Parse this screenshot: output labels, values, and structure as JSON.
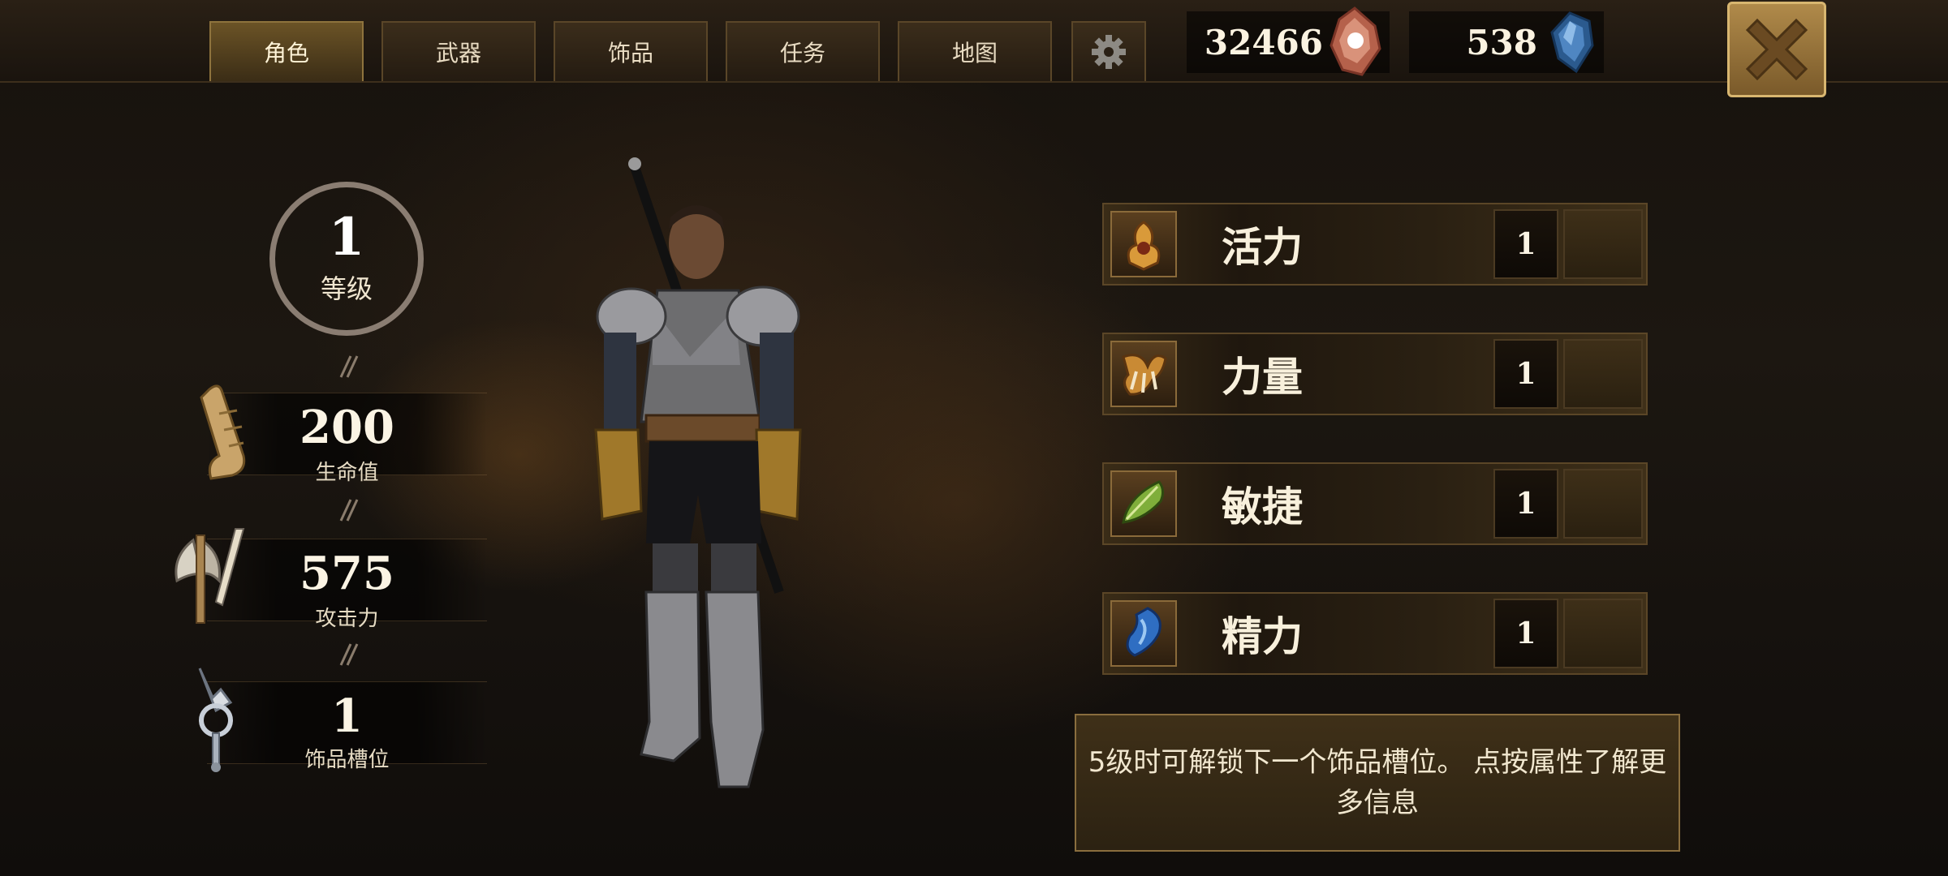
{
  "tabs": [
    {
      "label": "角色",
      "active": true
    },
    {
      "label": "武器",
      "active": false
    },
    {
      "label": "饰品",
      "active": false
    },
    {
      "label": "任务",
      "active": false
    },
    {
      "label": "地图",
      "active": false
    }
  ],
  "currency": {
    "crystals": "32466",
    "gems": "538"
  },
  "level": {
    "value": "1",
    "label": "等级"
  },
  "stats": [
    {
      "value": "200",
      "label": "生命值",
      "icon": "scroll-icon"
    },
    {
      "value": "575",
      "label": "攻击力",
      "icon": "axe-icon"
    },
    {
      "value": "1",
      "label": "饰品槽位",
      "icon": "amulet-icon"
    }
  ],
  "attributes": [
    {
      "name": "活力",
      "value": "1",
      "icon": "vitality-icon"
    },
    {
      "name": "力量",
      "value": "1",
      "icon": "strength-icon"
    },
    {
      "name": "敏捷",
      "value": "1",
      "icon": "agility-icon"
    },
    {
      "name": "精力",
      "value": "1",
      "icon": "energy-icon"
    }
  ],
  "info_text": "5级时可解锁下一个饰品槽位。 点按属性了解更多信息"
}
